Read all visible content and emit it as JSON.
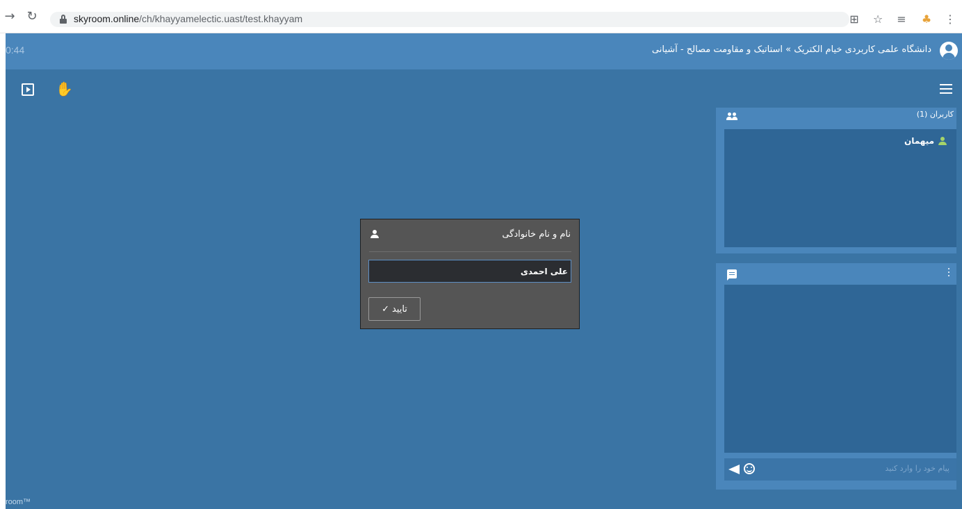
{
  "browser": {
    "back_icon": "arrow-right",
    "reload_icon": "reload",
    "url_domain": "skyroom.online",
    "url_path": "/ch/khayyamelectic.uast/test.khayyam",
    "icons": [
      "translate-icon",
      "star-icon",
      "reading-list-icon",
      "profile-icon",
      "more-icon"
    ]
  },
  "header": {
    "timer": "0:44",
    "title": "دانشگاه علمی کاربردی خیام الکتریک » استاتیک و مقاومت مصالح - آشیانی"
  },
  "users_panel": {
    "title": "کاربران (1)",
    "users": [
      {
        "name": "میهمان"
      }
    ]
  },
  "chat_panel": {
    "placeholder": "پیام خود را وارد کنید"
  },
  "dialog": {
    "title": "نام و نام خانوادگی",
    "input_value": "علی احمدی",
    "confirm_label": "تایید"
  },
  "brand": "room™",
  "colors": {
    "app_bg": "#3a74a4",
    "header_bg": "#4a86bb",
    "panel_bg": "#4a86bb",
    "panel_inner": "#2f6696",
    "dialog_bg": "#555555",
    "user_green": "#a4d36a"
  }
}
